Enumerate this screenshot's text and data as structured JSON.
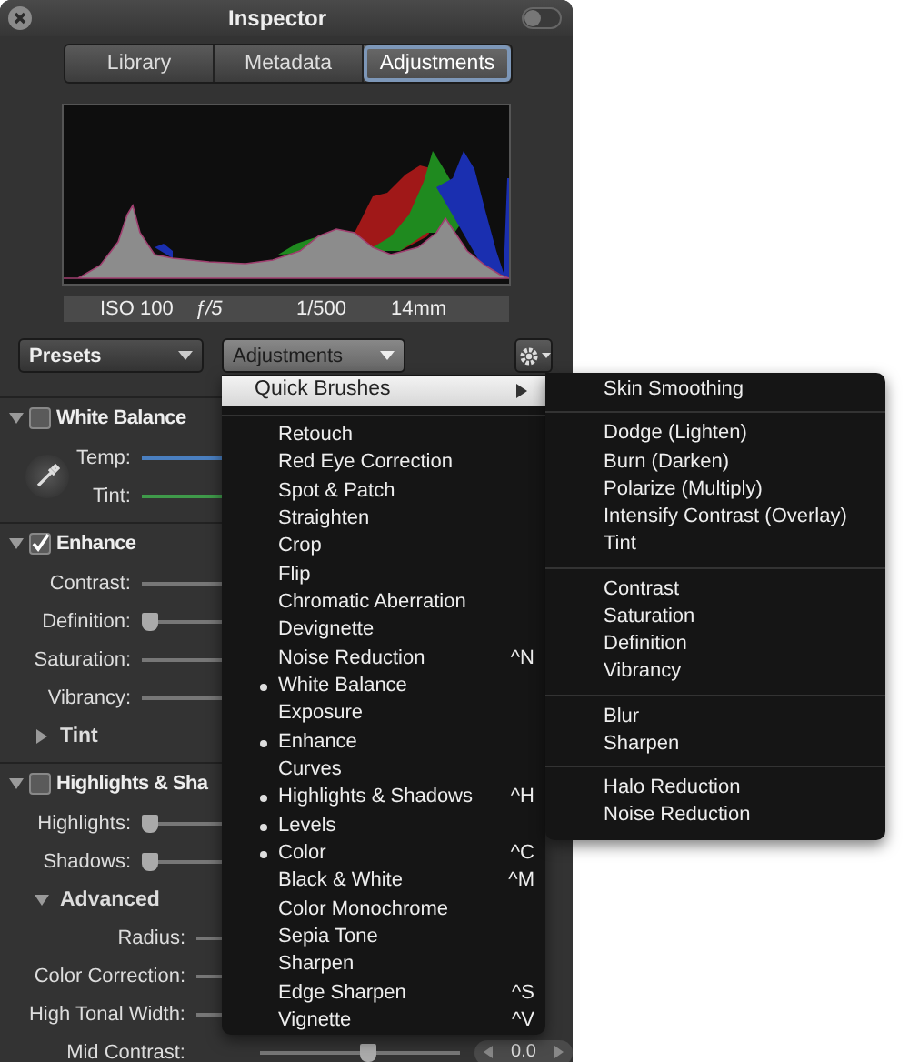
{
  "window": {
    "title": "Inspector"
  },
  "tabs": [
    {
      "label": "Library",
      "selected": false
    },
    {
      "label": "Metadata",
      "selected": false
    },
    {
      "label": "Adjustments",
      "selected": true
    }
  ],
  "exif": [
    "ISO 100",
    "ƒ/5",
    "1/500",
    "14mm"
  ],
  "toolbar": {
    "presets": {
      "label": "Presets",
      "open": false
    },
    "adjustments": {
      "label": "Adjustments",
      "open": true
    }
  },
  "sections": [
    {
      "title": "White Balance",
      "checked": false,
      "expanded": true,
      "has_eyedropper": true,
      "items": [
        {
          "kind": "temperature",
          "label": "Temp:"
        },
        {
          "kind": "tint",
          "label": "Tint:"
        }
      ]
    },
    {
      "title": "Enhance",
      "checked": true,
      "expanded": true,
      "items": [
        {
          "kind": "slider",
          "label": "Contrast:"
        },
        {
          "kind": "slider",
          "label": "Definition:",
          "level": 0
        },
        {
          "kind": "slider",
          "label": "Saturation:"
        },
        {
          "kind": "slider",
          "label": "Vibrancy:"
        },
        {
          "kind": "group",
          "label": "Tint",
          "expanded": false
        }
      ]
    },
    {
      "title": "Highlights & Sha",
      "checked": false,
      "expanded": true,
      "items": [
        {
          "kind": "slider",
          "label": "Highlights:",
          "level": 0
        },
        {
          "kind": "slider",
          "label": "Shadows:",
          "level": 0
        },
        {
          "kind": "group",
          "label": "Advanced",
          "expanded": true,
          "children": [
            {
              "kind": "slider",
              "label": "Radius:"
            },
            {
              "kind": "slider",
              "label": "Color Correction:"
            },
            {
              "kind": "slider",
              "label": "High Tonal Width:"
            },
            {
              "kind": "slider",
              "label": "Mid Contrast:",
              "level": 0.5,
              "value": "0.0"
            }
          ]
        }
      ]
    }
  ],
  "menu": {
    "groups": [
      {
        "items": [
          {
            "label": "Quick Brushes",
            "selected": true,
            "checked": false,
            "submenu": true
          }
        ]
      },
      {
        "items": [
          {
            "label": "Retouch",
            "selected": false,
            "checked": false
          },
          {
            "label": "Red Eye Correction",
            "selected": false,
            "checked": false
          },
          {
            "label": "Spot & Patch",
            "selected": false,
            "checked": false
          },
          {
            "label": "Straighten",
            "selected": false,
            "checked": false
          },
          {
            "label": "Crop",
            "selected": false,
            "checked": false
          },
          {
            "label": "Flip",
            "selected": false,
            "checked": false
          },
          {
            "label": "Chromatic Aberration",
            "selected": false,
            "checked": false
          },
          {
            "label": "Devignette",
            "selected": false,
            "checked": false
          },
          {
            "label": "Noise Reduction",
            "selected": false,
            "checked": false,
            "shortcut": "^N"
          },
          {
            "label": "White Balance",
            "selected": false,
            "checked": true
          },
          {
            "label": "Exposure",
            "selected": false,
            "checked": false
          },
          {
            "label": "Enhance",
            "selected": false,
            "checked": true
          },
          {
            "label": "Curves",
            "selected": false,
            "checked": false
          },
          {
            "label": "Highlights & Shadows",
            "selected": false,
            "checked": true,
            "shortcut": "^H"
          },
          {
            "label": "Levels",
            "selected": false,
            "checked": true
          },
          {
            "label": "Color",
            "selected": false,
            "checked": true,
            "shortcut": "^C"
          },
          {
            "label": "Black & White",
            "selected": false,
            "checked": false,
            "shortcut": "^M"
          },
          {
            "label": "Color Monochrome",
            "selected": false,
            "checked": false
          },
          {
            "label": "Sepia Tone",
            "selected": false,
            "checked": false
          },
          {
            "label": "Sharpen",
            "selected": false,
            "checked": false
          },
          {
            "label": "Edge Sharpen",
            "selected": false,
            "checked": false,
            "shortcut": "^S"
          },
          {
            "label": "Vignette",
            "selected": false,
            "checked": false,
            "shortcut": "^V"
          }
        ]
      }
    ]
  },
  "submenu": {
    "groups": [
      [
        "Skin Smoothing"
      ],
      [
        "Dodge (Lighten)",
        "Burn (Darken)",
        "Polarize (Multiply)",
        "Intensify Contrast (Overlay)",
        "Tint"
      ],
      [
        "Contrast",
        "Saturation",
        "Definition",
        "Vibrancy"
      ],
      [
        "Blur",
        "Sharpen"
      ],
      [
        "Halo Reduction",
        "Noise Reduction"
      ]
    ]
  }
}
